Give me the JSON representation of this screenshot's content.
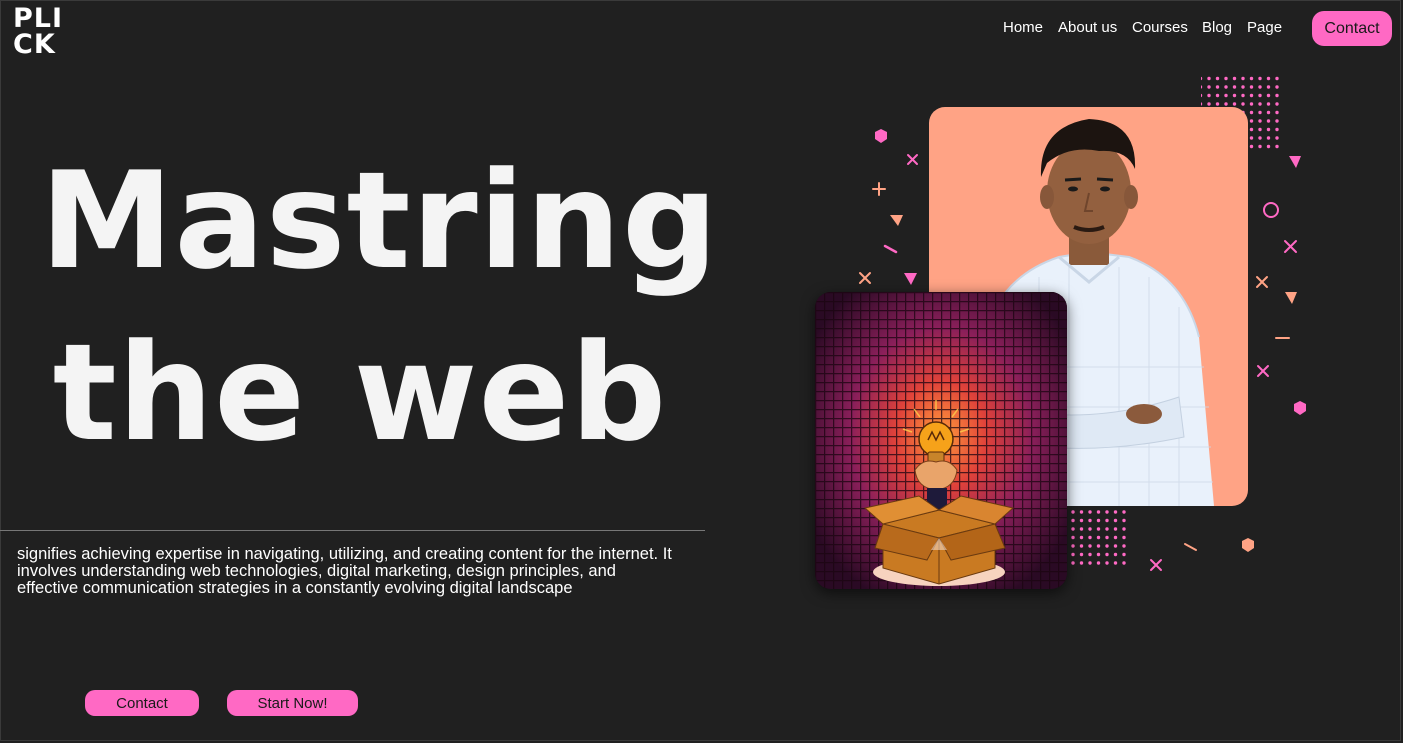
{
  "brand": {
    "logo_line1": "PLI",
    "logo_line2": "CK"
  },
  "nav": {
    "items": [
      "Home",
      "About us",
      "Courses",
      "Blog",
      "Page"
    ],
    "contact_label": "Contact"
  },
  "hero": {
    "title_line1": "Mastring",
    "title_line2": "the web",
    "description": "signifies achieving expertise in navigating, utilizing, and creating content for the internet. It involves understanding web technologies, digital marketing, design principles, and effective communication strategies in a constantly evolving digital landscape",
    "contact_button": "Contact",
    "start_button": "Start Now!"
  },
  "colors": {
    "background": "#202020",
    "accent_pink": "#ff69c4",
    "accent_peach": "#ffa385",
    "text": "#ffffff"
  },
  "icons": [
    "lightbulb-icon",
    "box-icon",
    "hand-icon"
  ]
}
